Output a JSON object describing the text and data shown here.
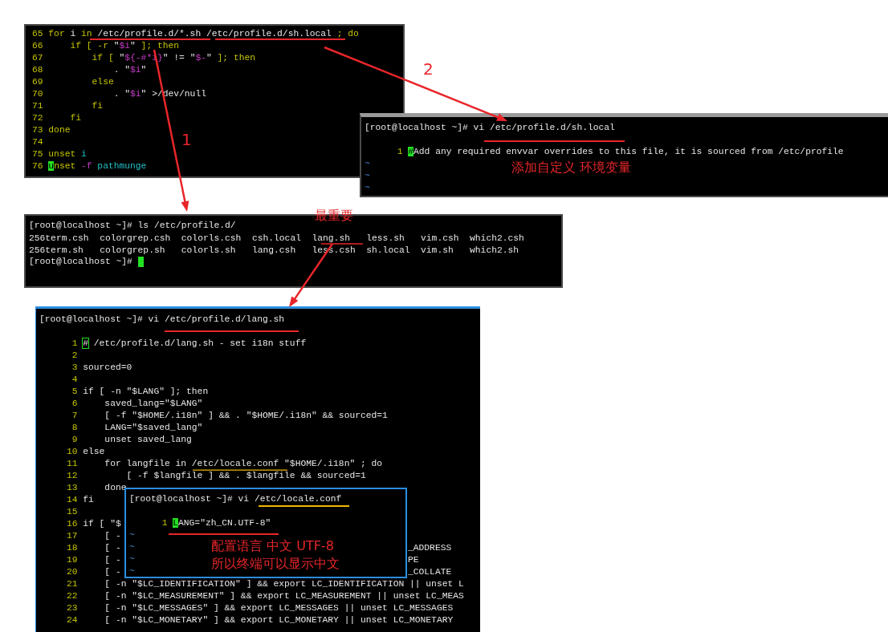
{
  "terminals": [
    {
      "kind": "editor",
      "lines": [
        {
          "num": "65",
          "tokens": [
            {
              "kind": "kw",
              "text": "for "
            },
            {
              "kind": "plain",
              "text": "i "
            },
            {
              "kind": "kw",
              "text": "in "
            },
            {
              "kind": "plain",
              "text": "/etc/profile.d/*.sh /etc/profile.d/sh.local "
            },
            {
              "kind": "kw",
              "text": "; do"
            }
          ]
        },
        {
          "num": "66",
          "tokens": [
            {
              "kind": "kw",
              "text": "    if [ -r "
            },
            {
              "kind": "plain",
              "text": "\""
            },
            {
              "kind": "var",
              "text": "$i"
            },
            {
              "kind": "plain",
              "text": "\""
            },
            {
              "kind": "kw",
              "text": " ]; then"
            }
          ]
        },
        {
          "num": "67",
          "tokens": [
            {
              "kind": "kw",
              "text": "        if [ "
            },
            {
              "kind": "plain",
              "text": "\""
            },
            {
              "kind": "var",
              "text": "${-#*i}"
            },
            {
              "kind": "plain",
              "text": "\" != \""
            },
            {
              "kind": "var",
              "text": "$-"
            },
            {
              "kind": "plain",
              "text": "\""
            },
            {
              "kind": "kw",
              "text": " ]; then"
            }
          ]
        },
        {
          "num": "68",
          "tokens": [
            {
              "kind": "plain",
              "text": "            . \""
            },
            {
              "kind": "var",
              "text": "$i"
            },
            {
              "kind": "plain",
              "text": "\""
            }
          ]
        },
        {
          "num": "69",
          "tokens": [
            {
              "kind": "kw",
              "text": "        else"
            }
          ]
        },
        {
          "num": "70",
          "tokens": [
            {
              "kind": "plain",
              "text": "            . \""
            },
            {
              "kind": "var",
              "text": "$i"
            },
            {
              "kind": "plain",
              "text": "\" >/dev/null"
            }
          ]
        },
        {
          "num": "71",
          "tokens": [
            {
              "kind": "kw",
              "text": "        fi"
            }
          ]
        },
        {
          "num": "72",
          "tokens": [
            {
              "kind": "kw",
              "text": "    fi"
            }
          ]
        },
        {
          "num": "73",
          "tokens": [
            {
              "kind": "kw",
              "text": "done"
            }
          ]
        },
        {
          "num": "74"
        },
        {
          "num": "75",
          "tokens": [
            {
              "kind": "kw",
              "text": "unset "
            },
            {
              "kind": "ident",
              "text": "i"
            }
          ]
        },
        {
          "num": "76",
          "tokens": [
            {
              "kind": "cursor",
              "text": "u"
            },
            {
              "kind": "kw",
              "text": "nset "
            },
            {
              "kind": "var",
              "text": "-f"
            },
            {
              "kind": "ident",
              "text": " pathmunge"
            }
          ]
        }
      ]
    },
    {
      "kind": "vi",
      "prompt": "[root@localhost ~]# vi /etc/profile.d/sh.local",
      "lines": [
        {
          "num": "1",
          "tokens": [
            {
              "kind": "cursor",
              "text": "#"
            },
            {
              "kind": "plain",
              "text": "Add any required envvar overrides to this file, it is sourced from /etc/profile"
            }
          ]
        }
      ],
      "tildes": [
        "~",
        "~",
        "~"
      ]
    },
    {
      "kind": "shell",
      "prompt": "[root@localhost ~]# ls /etc/profile.d/",
      "files": [
        "256term.csh",
        "colorgrep.csh",
        "colorls.csh",
        "csh.local",
        "lang.sh",
        "less.sh",
        "vim.csh",
        "which2.csh",
        "256term.sh",
        "colorgrep.sh",
        "colorls.sh",
        "lang.csh",
        "less.csh",
        "sh.local",
        "vim.sh",
        "which2.sh"
      ],
      "prompt_end": "[root@localhost ~]# "
    },
    {
      "kind": "vi",
      "prompt": "[root@localhost ~]# vi /etc/profile.d/lang.sh",
      "lines": [
        {
          "num": "1",
          "tokens": [
            {
              "kind": "cursor-outline",
              "text": "#"
            },
            {
              "kind": "plain",
              "text": " /etc/profile.d/lang.sh - set i18n stuff"
            }
          ]
        },
        {
          "num": "2"
        },
        {
          "num": "3",
          "tokens": [
            {
              "kind": "plain",
              "text": "sourced=0"
            }
          ]
        },
        {
          "num": "4"
        },
        {
          "num": "5",
          "tokens": [
            {
              "kind": "plain",
              "text": "if [ -n \"$LANG\" ]; then"
            }
          ]
        },
        {
          "num": "6",
          "tokens": [
            {
              "kind": "plain",
              "text": "    saved_lang=\"$LANG\""
            }
          ]
        },
        {
          "num": "7",
          "tokens": [
            {
              "kind": "plain",
              "text": "    [ -f \"$HOME/.i18n\" ] && . \"$HOME/.i18n\" && sourced=1"
            }
          ]
        },
        {
          "num": "8",
          "tokens": [
            {
              "kind": "plain",
              "text": "    LANG=\"$saved_lang\""
            }
          ]
        },
        {
          "num": "9",
          "tokens": [
            {
              "kind": "plain",
              "text": "    unset saved_lang"
            }
          ]
        },
        {
          "num": "10",
          "tokens": [
            {
              "kind": "plain",
              "text": "else"
            }
          ]
        },
        {
          "num": "11",
          "tokens": [
            {
              "kind": "plain",
              "text": "    for langfile in /etc/locale.conf \"$HOME/.i18n\" ; do"
            }
          ]
        },
        {
          "num": "12",
          "tokens": [
            {
              "kind": "plain",
              "text": "        [ -f $langfile ] && . $langfile && sourced=1"
            }
          ]
        },
        {
          "num": "13",
          "tokens": [
            {
              "kind": "plain",
              "text": "    done"
            }
          ]
        },
        {
          "num": "14",
          "tokens": [
            {
              "kind": "plain",
              "text": "fi"
            }
          ]
        },
        {
          "num": "15"
        },
        {
          "num": "16",
          "tokens": [
            {
              "kind": "plain",
              "text": "if [ \"$"
            }
          ]
        },
        {
          "num": "17",
          "tokens": [
            {
              "kind": "plain",
              "text": "    [ -"
            }
          ]
        },
        {
          "num": "18",
          "tokens": [
            {
              "kind": "plain",
              "text": "    [ -"
            }
          ],
          "tail": "_ADDRESS"
        },
        {
          "num": "19",
          "tokens": [
            {
              "kind": "plain",
              "text": "    [ -"
            }
          ],
          "tail": "PE"
        },
        {
          "num": "20",
          "tokens": [
            {
              "kind": "plain",
              "text": "    [ -"
            }
          ],
          "tail": "_COLLATE"
        },
        {
          "num": "21",
          "tokens": [
            {
              "kind": "plain",
              "text": "    [ -n \"$LC_IDENTIFICATION\" ] && export LC_IDENTIFICATION || unset L"
            }
          ]
        },
        {
          "num": "22",
          "tokens": [
            {
              "kind": "plain",
              "text": "    [ -n \"$LC_MEASUREMENT\" ] && export LC_MEASUREMENT || unset LC_MEAS"
            }
          ]
        },
        {
          "num": "23",
          "tokens": [
            {
              "kind": "plain",
              "text": "    [ -n \"$LC_MESSAGES\" ] && export LC_MESSAGES || unset LC_MESSAGES"
            }
          ]
        },
        {
          "num": "24",
          "tokens": [
            {
              "kind": "plain",
              "text": "    [ -n \"$LC_MONETARY\" ] && export LC_MONETARY || unset LC_MONETARY"
            }
          ]
        }
      ]
    },
    {
      "kind": "vi",
      "prompt": "[root@localhost ~]# vi /etc/locale.conf",
      "lines": [
        {
          "num": "1",
          "tokens": [
            {
              "kind": "cursor",
              "text": "L"
            },
            {
              "kind": "plain",
              "text": "ANG=\"zh_CN.UTF-8\""
            }
          ]
        }
      ],
      "tildes": [
        "~",
        "~",
        "~",
        "~"
      ]
    }
  ],
  "annotations": [
    {
      "kind": "number",
      "text": "1"
    },
    {
      "kind": "number",
      "text": "2"
    },
    {
      "kind": "note",
      "text": "添加自定义 环境变量"
    },
    {
      "kind": "note",
      "text": "最重要"
    },
    {
      "kind": "note",
      "text": "配置语言 中文 UTF-8"
    },
    {
      "kind": "note",
      "text": "所以终端可以显示中文"
    }
  ]
}
